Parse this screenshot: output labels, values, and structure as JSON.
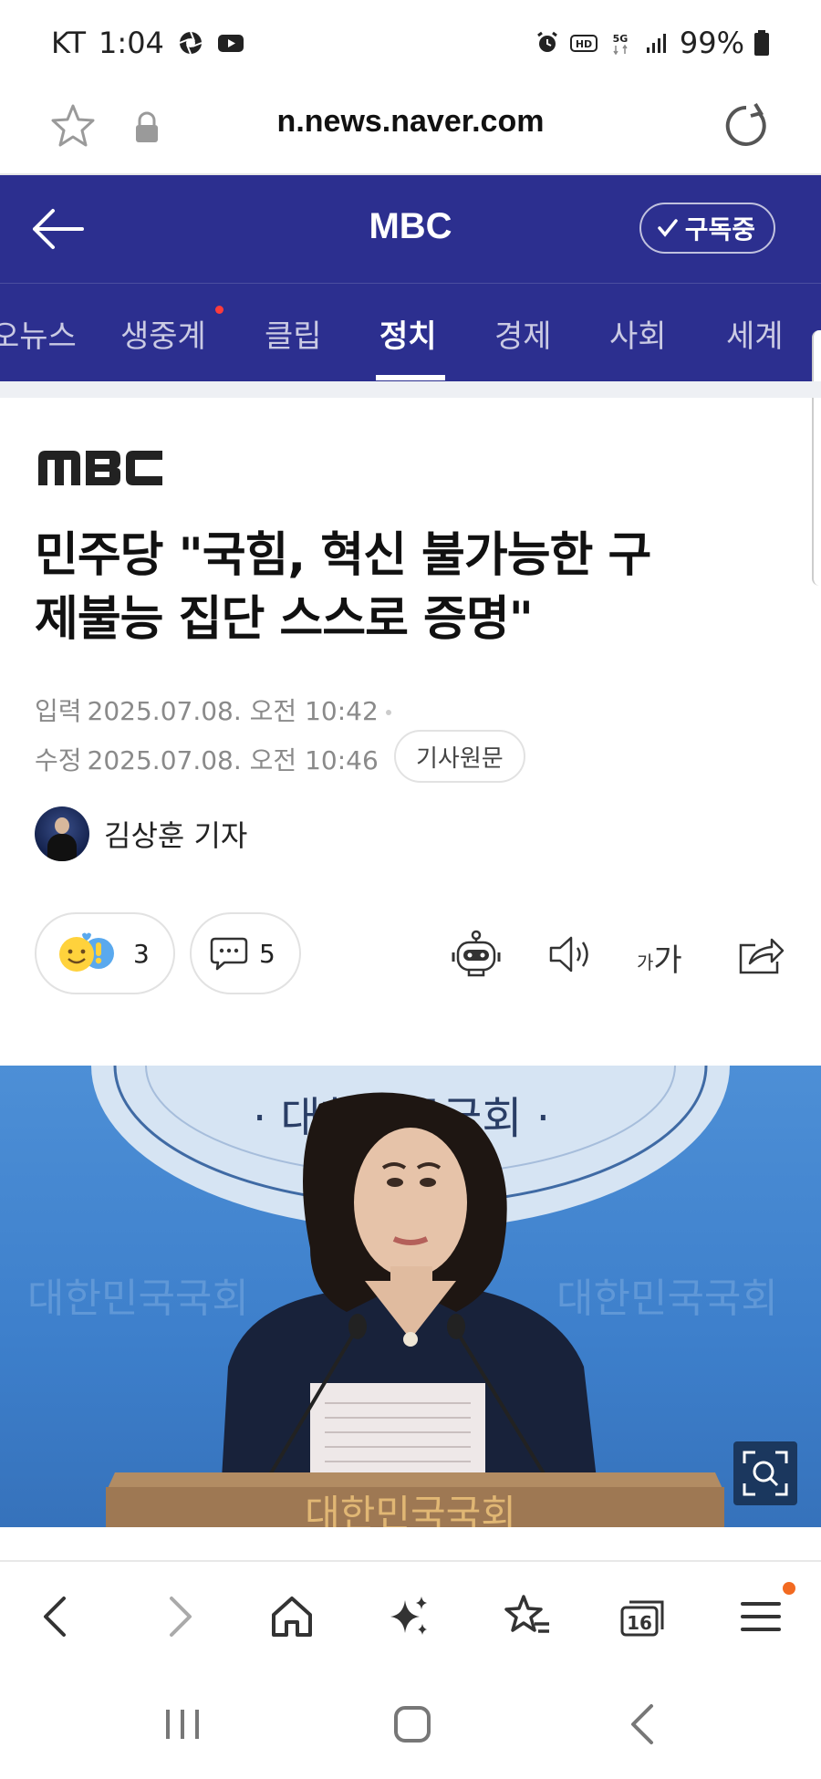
{
  "status_bar": {
    "carrier": "KT",
    "time": "1:04",
    "battery": "99%"
  },
  "url_bar": {
    "url": "n.news.naver.com"
  },
  "header": {
    "back_icon": "back-arrow-icon",
    "press_name": "MBC",
    "subscribe_label": "구독중"
  },
  "categories": {
    "items": [
      {
        "label": "오뉴스"
      },
      {
        "label": "생중계"
      },
      {
        "label": "클립"
      },
      {
        "label": "정치"
      },
      {
        "label": "경제"
      },
      {
        "label": "사회"
      },
      {
        "label": "세계"
      }
    ],
    "active": "정치",
    "live_dot_color": "#ff3b3b"
  },
  "article": {
    "press_logo_text": "MBC",
    "headline_line1": "민주당 \"국힘, 혁신 불가능한 구",
    "headline_line2": "제불능 집단 스스로 증명\"",
    "input_label": "입력",
    "input_time": "2025.07.08. 오전 10:42",
    "edit_label": "수정",
    "edit_time": "2025.07.08. 오전 10:46",
    "original_button": "기사원문",
    "reporter": "김상훈 기자",
    "reaction_count": "3",
    "comment_count": "5",
    "font_size_label_small": "가",
    "font_size_label_large": "가"
  },
  "photo": {
    "seal_text": "· 대한민국국회 ·",
    "backdrop_text": "대한민국국회",
    "podium_text": "대한민국국회"
  },
  "toolbar": {
    "tabs_count": "16",
    "notification_color": "#f26a21"
  },
  "colors": {
    "header_bg": "#2c2f8f",
    "text_primary": "#111111",
    "meta_gray": "#8a8a8a"
  }
}
